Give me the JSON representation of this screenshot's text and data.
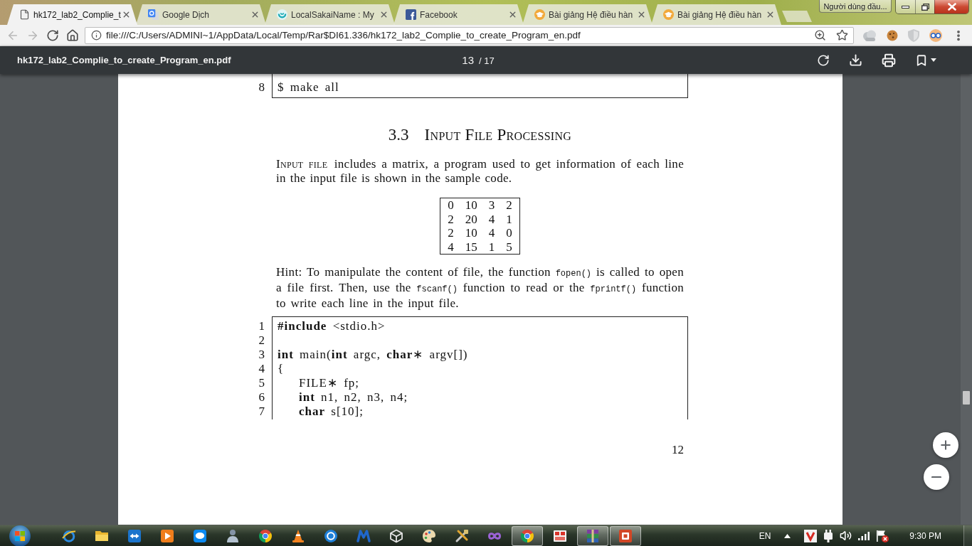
{
  "browser": {
    "tabs": [
      {
        "kind": "file",
        "title": "hk172_lab2_Complie_t",
        "selected": true
      },
      {
        "kind": "translate",
        "title": "Google Dịch",
        "selected": false
      },
      {
        "kind": "sakai",
        "title": "LocalSakaiName : My",
        "selected": false
      },
      {
        "kind": "facebook",
        "title": "Facebook",
        "selected": false
      },
      {
        "kind": "course",
        "title": "Bài giảng Hệ điều hàn",
        "selected": false
      },
      {
        "kind": "course",
        "title": "Bài giảng Hệ điều hàn",
        "selected": false
      }
    ],
    "profile": "Người dùng đầu...",
    "nav": [
      {
        "kind": "back",
        "disabled": true
      },
      {
        "kind": "forward",
        "disabled": true
      },
      {
        "kind": "reload",
        "disabled": false
      },
      {
        "kind": "home",
        "disabled": false
      }
    ],
    "address": "file:///C:/Users/ADMINI~1/AppData/Local/Temp/Rar$DI61.336/hk172_lab2_Complie_to_create_Program_en.pdf"
  },
  "pdf_toolbar": {
    "file_name": "hk172_lab2_Complie_to_create_Program_en.pdf",
    "page": "13",
    "page_total": "/ 17"
  },
  "document": {
    "listing_tail": {
      "lines": [
        {
          "number": "8",
          "code": "$ make all"
        }
      ]
    },
    "section": {
      "number": "3.3",
      "title": "Input File Processing"
    },
    "intro": {
      "lead": "Input file",
      "text": "includes a matrix, a program used to get information of each line in the input file is shown in the sample code."
    },
    "matrix": {
      "rows": [
        [
          "0",
          "10",
          "3",
          "2"
        ],
        [
          "2",
          "20",
          "4",
          "1"
        ],
        [
          "2",
          "10",
          "4",
          "0"
        ],
        [
          "4",
          "15",
          "1",
          "5"
        ]
      ]
    },
    "hint": [
      {
        "kind": "text",
        "text": "Hint: To manipulate the content of file, the function "
      },
      {
        "kind": "code",
        "text": "fopen()"
      },
      {
        "kind": "text",
        "text": " is called to open a file first. Then, use the "
      },
      {
        "kind": "code",
        "text": "fscanf()"
      },
      {
        "kind": "text",
        "text": " function to read or the "
      },
      {
        "kind": "code",
        "text": "fprintf()"
      },
      {
        "kind": "text",
        "text": " function to write each line in the input file."
      }
    ],
    "listing": {
      "lines": [
        {
          "number": "1",
          "code": "**#include** <stdio.h>"
        },
        {
          "number": "2"
        },
        {
          "number": "3",
          "code": "**int** main(**int** argc, **char**∗ argv[])"
        },
        {
          "number": "4",
          "code": "{",
          "children": [
            {
              "number": "5",
              "code": "FILE∗ fp;"
            },
            {
              "number": "6",
              "code": "**int** n1, n2, n3, n4;"
            },
            {
              "number": "7",
              "code": "**char** s[10];"
            }
          ]
        }
      ]
    },
    "page_number": "12"
  },
  "taskbar": {
    "apps": [
      {
        "kind": "ring",
        "running": false
      },
      {
        "kind": "folder",
        "running": false
      },
      {
        "kind": "arrows",
        "running": false
      },
      {
        "kind": "play",
        "running": false
      },
      {
        "kind": "chat",
        "running": false
      },
      {
        "kind": "person",
        "running": false
      },
      {
        "kind": "tricolor",
        "running": false
      },
      {
        "kind": "cone",
        "running": false
      },
      {
        "kind": "circle",
        "running": false
      },
      {
        "kind": "zigzag",
        "running": false
      },
      {
        "kind": "cube",
        "running": false
      },
      {
        "kind": "palette",
        "running": false
      },
      {
        "kind": "tools",
        "running": false
      },
      {
        "kind": "infinity",
        "running": false
      },
      {
        "kind": "tricolor",
        "running": true
      },
      {
        "kind": "grid",
        "running": false
      },
      {
        "kind": "books",
        "running": true
      },
      {
        "kind": "slides",
        "running": true
      }
    ],
    "language": "EN",
    "clock": "9:30 PM"
  }
}
